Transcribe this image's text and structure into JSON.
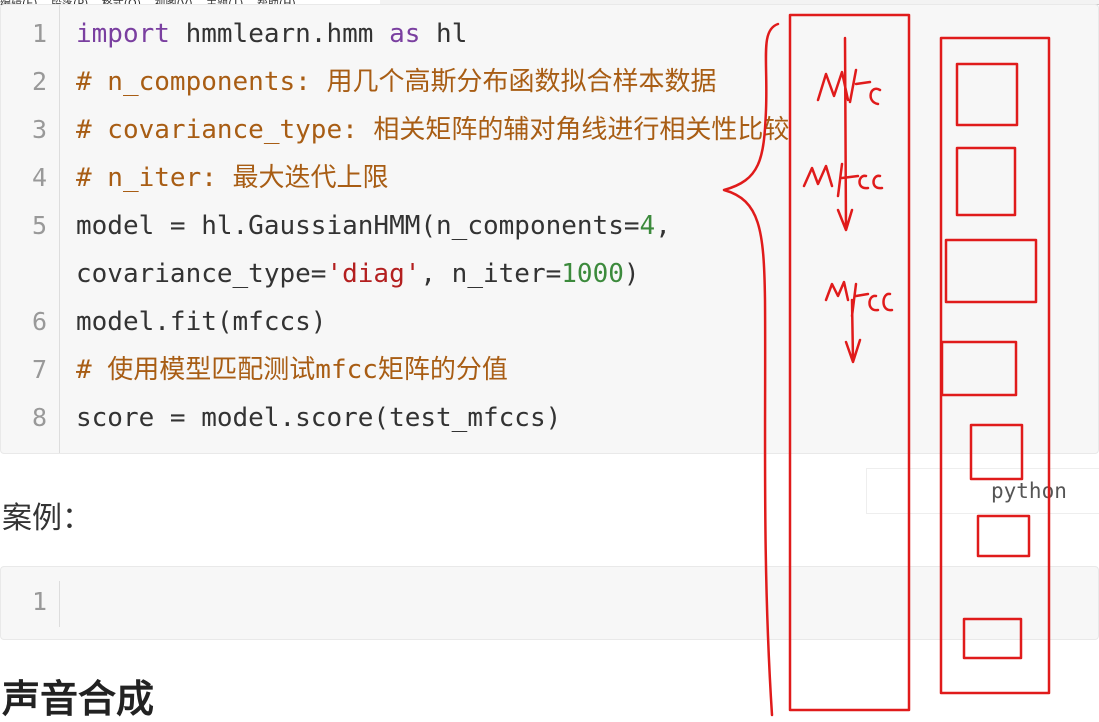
{
  "menu": {
    "items": [
      "编辑(E)",
      "段落(P)",
      "格式(O)",
      "视图(V)",
      "主题(T)",
      "帮助(H)"
    ]
  },
  "code_block_1": {
    "line_numbers": [
      "1",
      "2",
      "3",
      "4",
      "5",
      "",
      "6",
      "7",
      "8"
    ],
    "lines": {
      "l1_kw": "import",
      "l1_mod": " hmmlearn.hmm ",
      "l1_as": "as",
      "l1_alias": " hl",
      "l2": "# n_components: 用几个高斯分布函数拟合样本数据",
      "l3": "# covariance_type: 相关矩阵的辅对角线进行相关性比较",
      "l4": "# n_iter: 最大迭代上限",
      "l5_a": "model = hl.GaussianHMM(n_components=",
      "l5_num": "4",
      "l5_b": ",",
      "l5w_a": "covariance_type=",
      "l5w_str": "'diag'",
      "l5w_b": ", n_iter=",
      "l5w_num": "1000",
      "l5w_c": ")",
      "l6": "model.fit(mfccs)",
      "l7": "# 使用模型匹配测试mfcc矩阵的分值",
      "l8": "score = model.score(test_mfccs)"
    }
  },
  "language_tag": "python",
  "case_label": "案例：",
  "code_block_2": {
    "line_numbers": [
      "1"
    ]
  },
  "section_heading": "声音合成",
  "annotations": {
    "handwriting": [
      "MFCC",
      "MFCC",
      "MFCC"
    ],
    "stroke_color": "#e01b1b"
  },
  "colors": {
    "keyword": "#7a3fa0",
    "comment": "#a85d14",
    "string": "#b31f1f",
    "number": "#3c8a3c",
    "line_number": "#999999"
  }
}
